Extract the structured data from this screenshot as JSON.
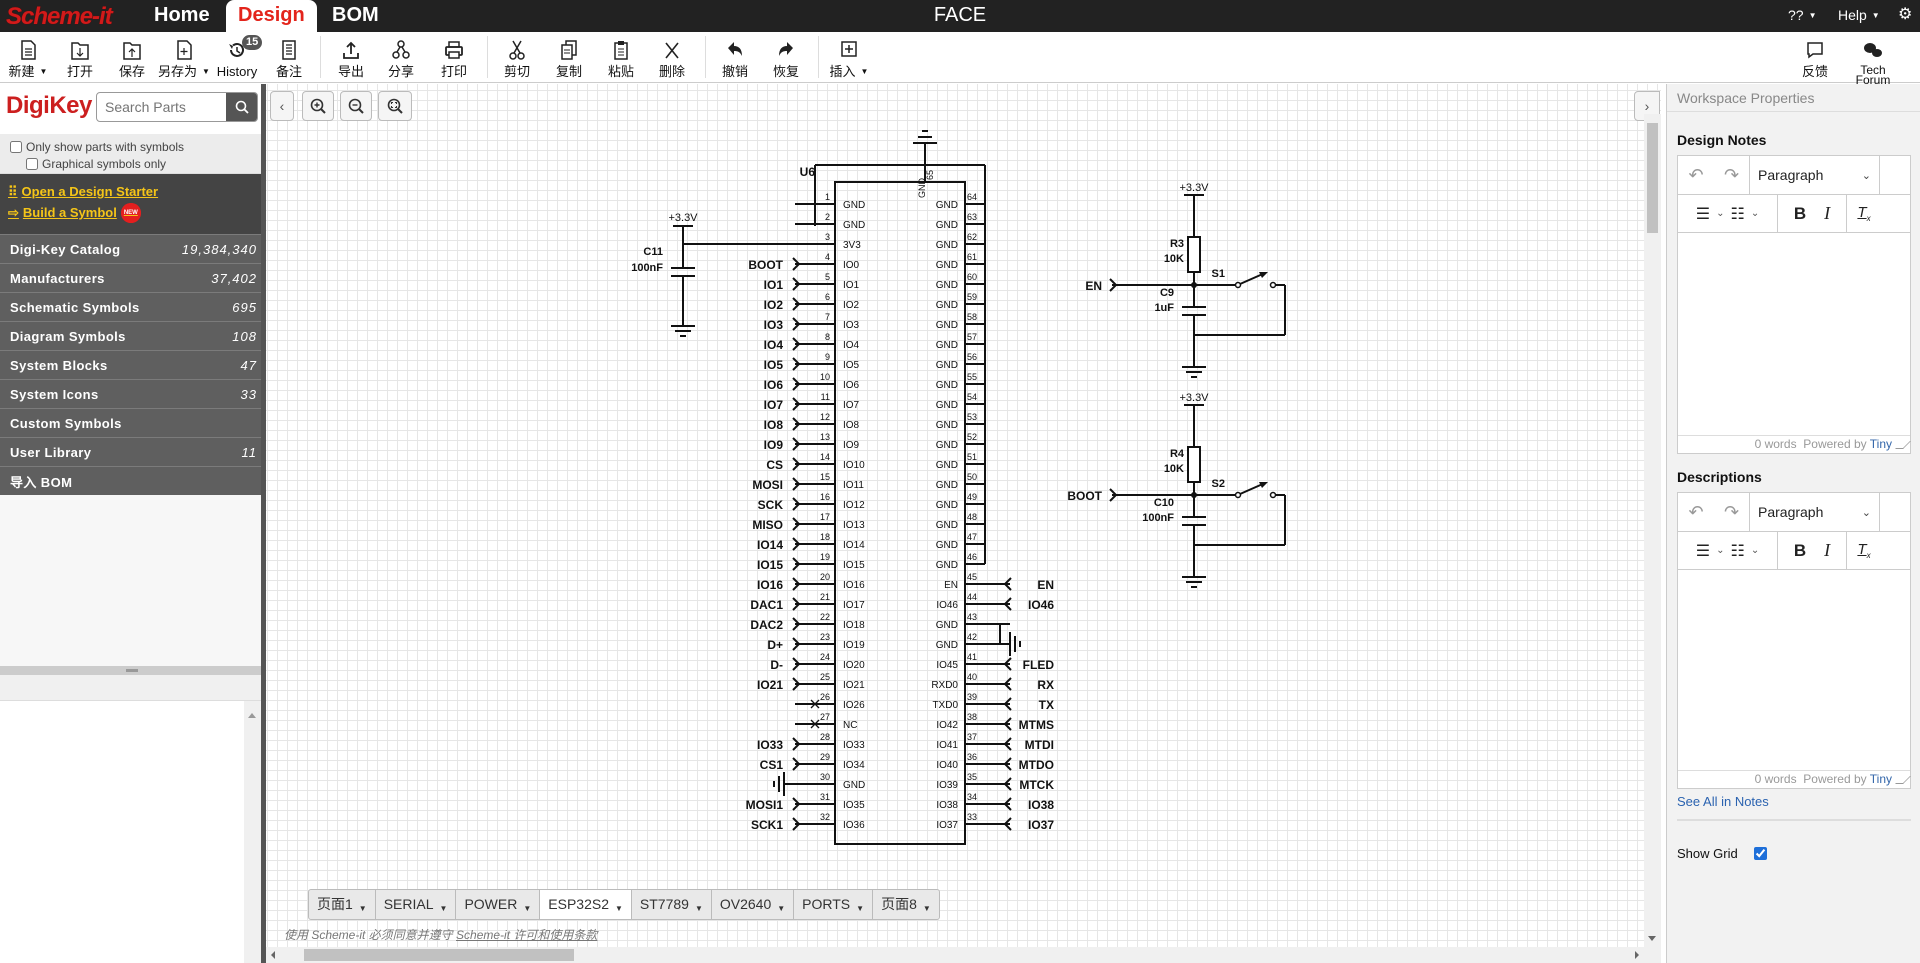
{
  "app": {
    "logo": "Scheme-it",
    "nav": [
      "Home",
      "Design",
      "BOM"
    ],
    "active_nav": "Design",
    "title": "FACE",
    "menus": {
      "language": "??",
      "help": "Help"
    }
  },
  "toolbar": {
    "items": [
      {
        "label": "新建",
        "icon": "new-doc-icon",
        "dropdown": true
      },
      {
        "label": "打开",
        "icon": "open-folder-icon"
      },
      {
        "label": "保存",
        "icon": "save-folder-icon"
      },
      {
        "label": "另存为",
        "icon": "save-as-icon",
        "dropdown": true
      },
      {
        "label": "History",
        "icon": "history-icon",
        "badge": "15"
      },
      {
        "label": "备注",
        "icon": "notes-icon"
      },
      {
        "label": "导出",
        "icon": "export-icon"
      },
      {
        "label": "分享",
        "icon": "share-icon"
      },
      {
        "label": "打印",
        "icon": "print-icon"
      },
      {
        "label": "剪切",
        "icon": "cut-icon"
      },
      {
        "label": "复制",
        "icon": "copy-icon"
      },
      {
        "label": "粘贴",
        "icon": "paste-icon"
      },
      {
        "label": "删除",
        "icon": "delete-icon"
      },
      {
        "label": "撤销",
        "icon": "undo-icon"
      },
      {
        "label": "恢复",
        "icon": "redo-icon"
      },
      {
        "label": "插入",
        "icon": "insert-icon",
        "dropdown": true
      }
    ],
    "feedback": "反馈",
    "tech_forum": [
      "Tech",
      "Forum"
    ]
  },
  "sidebar": {
    "brand": "DigiKey",
    "search_placeholder": "Search Parts",
    "filters": [
      "Only show parts with symbols",
      "Graphical symbols only"
    ],
    "links": [
      "Open a Design Starter",
      "Build a Symbol"
    ],
    "new_badge": "NEW",
    "categories": [
      {
        "label": "Digi-Key Catalog",
        "count": "19,384,340"
      },
      {
        "label": "Manufacturers",
        "count": "37,402"
      },
      {
        "label": "Schematic Symbols",
        "count": "695"
      },
      {
        "label": "Diagram Symbols",
        "count": "108"
      },
      {
        "label": "System Blocks",
        "count": "47"
      },
      {
        "label": "System Icons",
        "count": "33"
      },
      {
        "label": "Custom Symbols",
        "count": ""
      },
      {
        "label": "User Library",
        "count": "11"
      },
      {
        "label": "导入 BOM",
        "count": ""
      }
    ]
  },
  "canvas": {
    "page_tabs": [
      "页面1",
      "SERIAL",
      "POWER",
      "ESP32S2",
      "ST7789",
      "OV2640",
      "PORTS",
      "页面8"
    ],
    "active_tab": "ESP32S2",
    "license_prefix": "使用 Scheme-it 必须同意并遵守 ",
    "license_link": "Scheme-it 许可和使用条款",
    "schematic": {
      "chip": {
        "ref": "U6",
        "left_pins": [
          {
            "n": "1",
            "name": "GND",
            "net": ""
          },
          {
            "n": "2",
            "name": "GND",
            "net": ""
          },
          {
            "n": "3",
            "name": "3V3",
            "net": ""
          },
          {
            "n": "4",
            "name": "IO0",
            "net": "BOOT"
          },
          {
            "n": "5",
            "name": "IO1",
            "net": "IO1"
          },
          {
            "n": "6",
            "name": "IO2",
            "net": "IO2"
          },
          {
            "n": "7",
            "name": "IO3",
            "net": "IO3"
          },
          {
            "n": "8",
            "name": "IO4",
            "net": "IO4"
          },
          {
            "n": "9",
            "name": "IO5",
            "net": "IO5"
          },
          {
            "n": "10",
            "name": "IO6",
            "net": "IO6"
          },
          {
            "n": "11",
            "name": "IO7",
            "net": "IO7"
          },
          {
            "n": "12",
            "name": "IO8",
            "net": "IO8"
          },
          {
            "n": "13",
            "name": "IO9",
            "net": "IO9"
          },
          {
            "n": "14",
            "name": "IO10",
            "net": "CS"
          },
          {
            "n": "15",
            "name": "IO11",
            "net": "MOSI"
          },
          {
            "n": "16",
            "name": "IO12",
            "net": "SCK"
          },
          {
            "n": "17",
            "name": "IO13",
            "net": "MISO"
          },
          {
            "n": "18",
            "name": "IO14",
            "net": "IO14"
          },
          {
            "n": "19",
            "name": "IO15",
            "net": "IO15"
          },
          {
            "n": "20",
            "name": "IO16",
            "net": "IO16"
          },
          {
            "n": "21",
            "name": "IO17",
            "net": "DAC1"
          },
          {
            "n": "22",
            "name": "IO18",
            "net": "DAC2"
          },
          {
            "n": "23",
            "name": "IO19",
            "net": "D+"
          },
          {
            "n": "24",
            "name": "IO20",
            "net": "D-"
          },
          {
            "n": "25",
            "name": "IO21",
            "net": "IO21"
          },
          {
            "n": "26",
            "name": "IO26",
            "net": "NC-X"
          },
          {
            "n": "27",
            "name": "NC",
            "net": "NC-X"
          },
          {
            "n": "28",
            "name": "IO33",
            "net": "IO33"
          },
          {
            "n": "29",
            "name": "IO34",
            "net": "CS1"
          },
          {
            "n": "30",
            "name": "GND",
            "net": "GND-SYM"
          },
          {
            "n": "31",
            "name": "IO35",
            "net": "MOSI1"
          },
          {
            "n": "32",
            "name": "IO36",
            "net": "SCK1"
          }
        ],
        "right_pins": [
          {
            "n": "64",
            "name": "GND",
            "net": ""
          },
          {
            "n": "63",
            "name": "GND",
            "net": ""
          },
          {
            "n": "62",
            "name": "GND",
            "net": ""
          },
          {
            "n": "61",
            "name": "GND",
            "net": ""
          },
          {
            "n": "60",
            "name": "GND",
            "net": ""
          },
          {
            "n": "59",
            "name": "GND",
            "net": ""
          },
          {
            "n": "58",
            "name": "GND",
            "net": ""
          },
          {
            "n": "57",
            "name": "GND",
            "net": ""
          },
          {
            "n": "56",
            "name": "GND",
            "net": ""
          },
          {
            "n": "55",
            "name": "GND",
            "net": ""
          },
          {
            "n": "54",
            "name": "GND",
            "net": ""
          },
          {
            "n": "53",
            "name": "GND",
            "net": ""
          },
          {
            "n": "52",
            "name": "GND",
            "net": ""
          },
          {
            "n": "51",
            "name": "GND",
            "net": ""
          },
          {
            "n": "50",
            "name": "GND",
            "net": ""
          },
          {
            "n": "49",
            "name": "GND",
            "net": ""
          },
          {
            "n": "48",
            "name": "GND",
            "net": ""
          },
          {
            "n": "47",
            "name": "GND",
            "net": ""
          },
          {
            "n": "46",
            "name": "GND",
            "net": ""
          },
          {
            "n": "45",
            "name": "EN",
            "net": "EN"
          },
          {
            "n": "44",
            "name": "IO46",
            "net": "IO46"
          },
          {
            "n": "43",
            "name": "GND",
            "net": "GND-BUS"
          },
          {
            "n": "42",
            "name": "GND",
            "net": "GND-BUS"
          },
          {
            "n": "41",
            "name": "IO45",
            "net": "FLED"
          },
          {
            "n": "40",
            "name": "RXD0",
            "net": "RX"
          },
          {
            "n": "39",
            "name": "TXD0",
            "net": "TX"
          },
          {
            "n": "38",
            "name": "IO42",
            "net": "MTMS"
          },
          {
            "n": "37",
            "name": "IO41",
            "net": "MTDI"
          },
          {
            "n": "36",
            "name": "IO40",
            "net": "MTDO"
          },
          {
            "n": "35",
            "name": "IO39",
            "net": "MTCK"
          },
          {
            "n": "34",
            "name": "IO38",
            "net": "IO38"
          },
          {
            "n": "33",
            "name": "IO37",
            "net": "IO37"
          }
        ],
        "top_pin": {
          "n": "65",
          "name": "GND"
        }
      },
      "c11": {
        "ref": "C11",
        "value": "100nF",
        "power": "+3.3V"
      },
      "en_circuit": {
        "net": "EN",
        "r_ref": "R3",
        "r_val": "10K",
        "c_ref": "C9",
        "c_val": "1uF",
        "sw": "S1",
        "power": "+3.3V"
      },
      "boot_circuit": {
        "net": "BOOT",
        "r_ref": "R4",
        "r_val": "10K",
        "c_ref": "C10",
        "c_val": "100nF",
        "sw": "S2",
        "power": "+3.3V"
      }
    }
  },
  "right_panel": {
    "title": "Workspace Properties",
    "design_notes": "Design Notes",
    "descriptions": "Descriptions",
    "block_format": "Paragraph",
    "word_count": "0 words",
    "powered_by": "Powered by",
    "tiny": "Tiny",
    "see_all": "See All in Notes",
    "show_grid_label": "Show Grid",
    "show_grid": true
  }
}
